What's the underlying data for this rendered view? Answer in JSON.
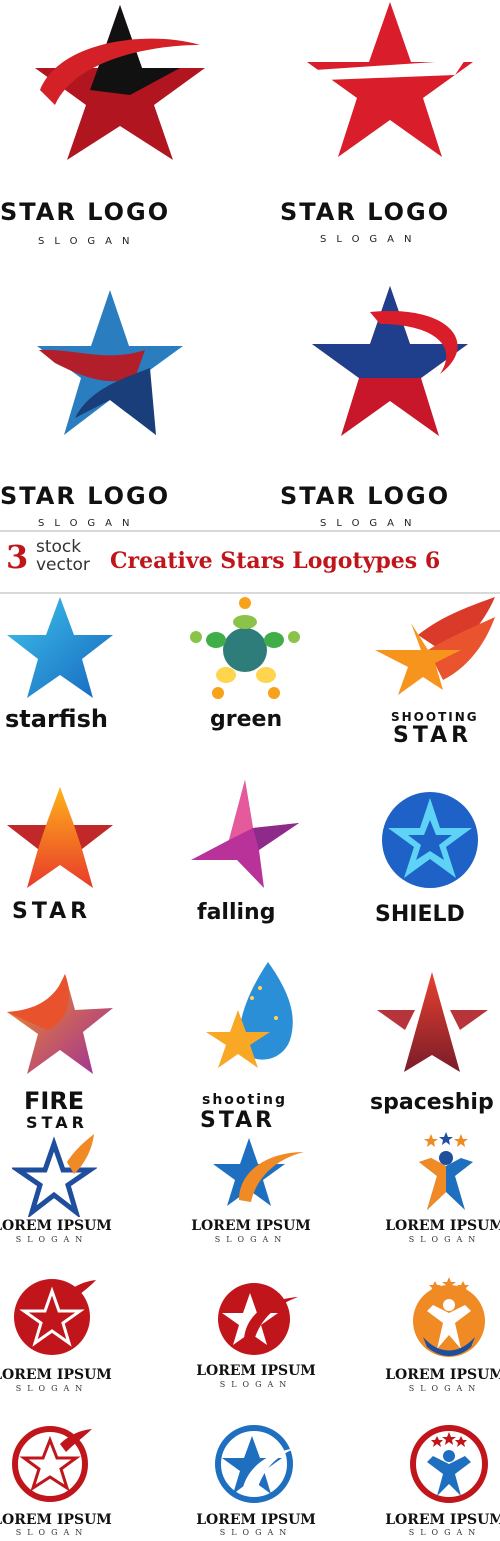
{
  "top_logos": [
    {
      "title": "STAR LOGO",
      "slogan": "SLOGAN"
    },
    {
      "title": "STAR LOGO",
      "slogan": "SLOGAN"
    },
    {
      "title": "STAR LOGO",
      "slogan": "SLOGAN"
    },
    {
      "title": "STAR LOGO",
      "slogan": "SLOGAN"
    }
  ],
  "banner": {
    "number": "3",
    "stock": "stock",
    "vector": "vector",
    "title": "Creative Stars Logotypes 6"
  },
  "grid_labels": {
    "starfish": "starfish",
    "green": "green",
    "shooting_small": "SHOOTING",
    "shooting_big": "STAR",
    "star": "STAR",
    "falling": "falling",
    "shield": "SHIELD",
    "fire": "FIRE",
    "fire_star": "STAR",
    "shooting2_small": "shooting",
    "shooting2_big": "STAR",
    "spaceship": "spaceship"
  },
  "lorem_logos": [
    {
      "title": "LOREM IPSUM",
      "slogan": "SLOGAN"
    },
    {
      "title": "LOREM IPSUM",
      "slogan": "SLOGAN"
    },
    {
      "title": "LOREM IPSUM",
      "slogan": "SLOGAN"
    },
    {
      "title": "LOREM IPSUM",
      "slogan": "SLOGAN"
    },
    {
      "title": "LOREM IPSUM",
      "slogan": "SLOGAN"
    },
    {
      "title": "LOREM IPSUM",
      "slogan": "SLOGAN"
    },
    {
      "title": "LOREM IPSUM",
      "slogan": "SLOGAN"
    },
    {
      "title": "LOREM IPSUM",
      "slogan": "SLOGAN"
    },
    {
      "title": "LOREM IPSUM",
      "slogan": "SLOGAN"
    }
  ],
  "colors": {
    "red": "#c0161b",
    "blue": "#1f4e9c",
    "orange": "#f08a24",
    "black": "#111111"
  }
}
